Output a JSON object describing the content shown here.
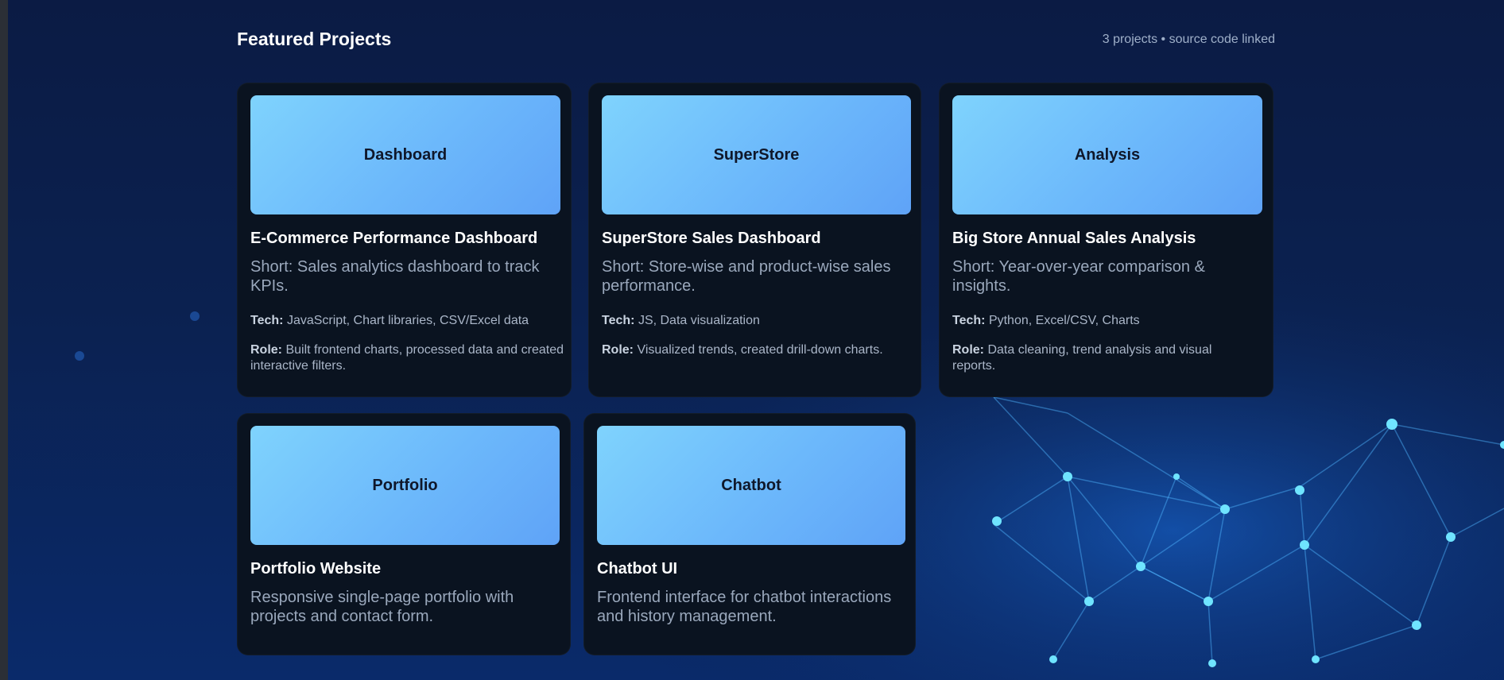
{
  "header": {
    "title": "Featured Projects",
    "meta": "3 projects • source code linked"
  },
  "projects": [
    {
      "thumb_label": "Dashboard",
      "title": "E-Commerce Performance Dashboard",
      "short": "Short: Sales analytics dashboard to track KPIs.",
      "tech_label": "Tech:",
      "tech": "JavaScript, Chart libraries, CSV/Excel data",
      "role_label": "Role:",
      "role": "Built frontend charts, processed data and created interactive filters."
    },
    {
      "thumb_label": "SuperStore",
      "title": "SuperStore Sales Dashboard",
      "short": "Short: Store-wise and product-wise sales performance.",
      "tech_label": "Tech:",
      "tech": "JS, Data visualization",
      "role_label": "Role:",
      "role": "Visualized trends, created drill-down charts."
    },
    {
      "thumb_label": "Analysis",
      "title": "Big Store Annual Sales Analysis",
      "short": "Short: Year-over-year comparison & insights.",
      "tech_label": "Tech:",
      "tech": "Python, Excel/CSV, Charts",
      "role_label": "Role:",
      "role": "Data cleaning, trend analysis and visual reports."
    },
    {
      "thumb_label": "Portfolio",
      "title": "Portfolio Website",
      "short": "Responsive single-page portfolio with projects and contact form."
    },
    {
      "thumb_label": "Chatbot",
      "title": "Chatbot UI",
      "short": "Frontend interface for chatbot interactions and history management."
    }
  ],
  "colors": {
    "background": "#0b2150",
    "card": "#0a1320",
    "thumb_gradient_start": "#7fd3fd",
    "thumb_gradient_end": "#5fa3f7",
    "network_glow": "#39c8ff"
  }
}
